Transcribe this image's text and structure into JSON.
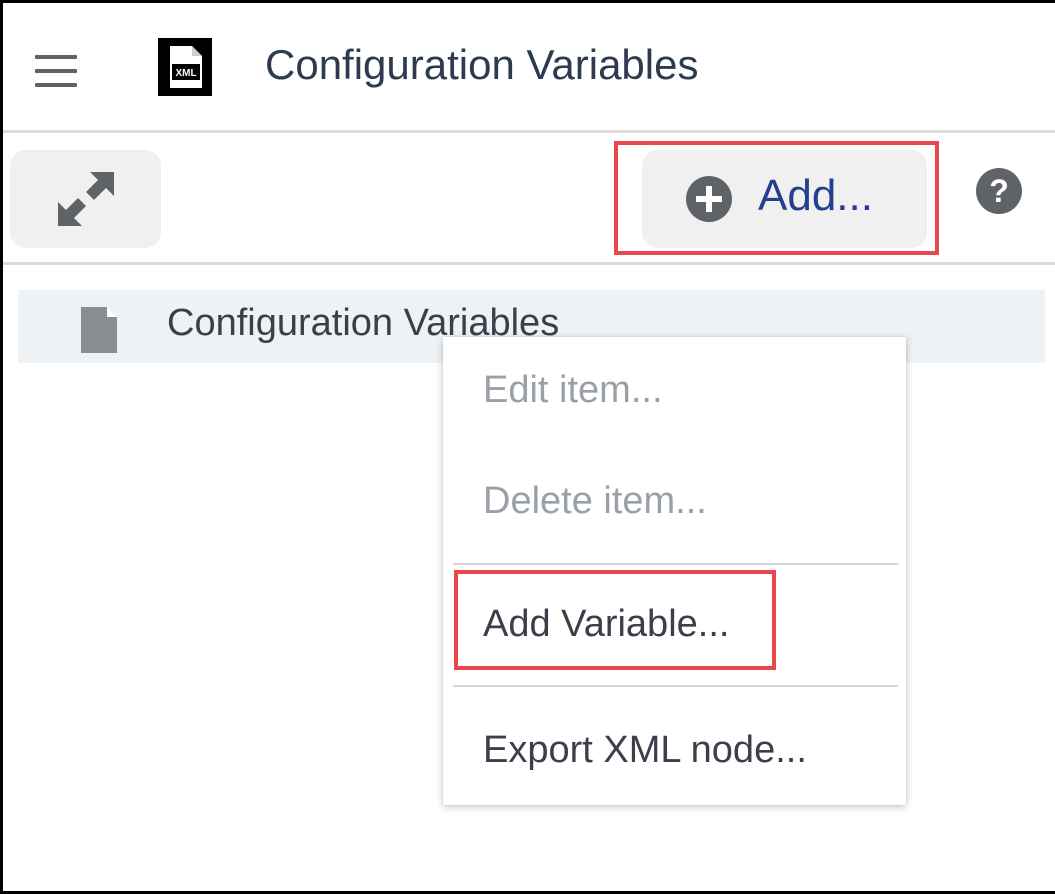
{
  "header": {
    "title": "Configuration Variables",
    "menu_icon": "hamburger-menu-icon",
    "app_icon": "xml-file-icon",
    "app_icon_text": "XML"
  },
  "toolbar": {
    "expand_icon": "expand-arrows-icon",
    "add_label": "Add...",
    "add_icon": "plus-circle-icon",
    "help_icon": "help-circle-icon"
  },
  "tree": {
    "items": [
      {
        "label": "Configuration Variables",
        "icon": "file-icon"
      }
    ]
  },
  "context_menu": {
    "items": [
      {
        "label": "Edit item...",
        "enabled": false
      },
      {
        "label": "Delete item...",
        "enabled": false
      },
      {
        "label": "Add Variable...",
        "enabled": true
      },
      {
        "label": "Export XML node...",
        "enabled": true
      }
    ]
  },
  "colors": {
    "highlight": "#e8474b",
    "accent_text": "#23408e",
    "title_text": "#2d3a4f",
    "disabled_text": "#9aa0a8",
    "button_bg": "#f0f0f0",
    "row_bg": "#eff2f5"
  }
}
